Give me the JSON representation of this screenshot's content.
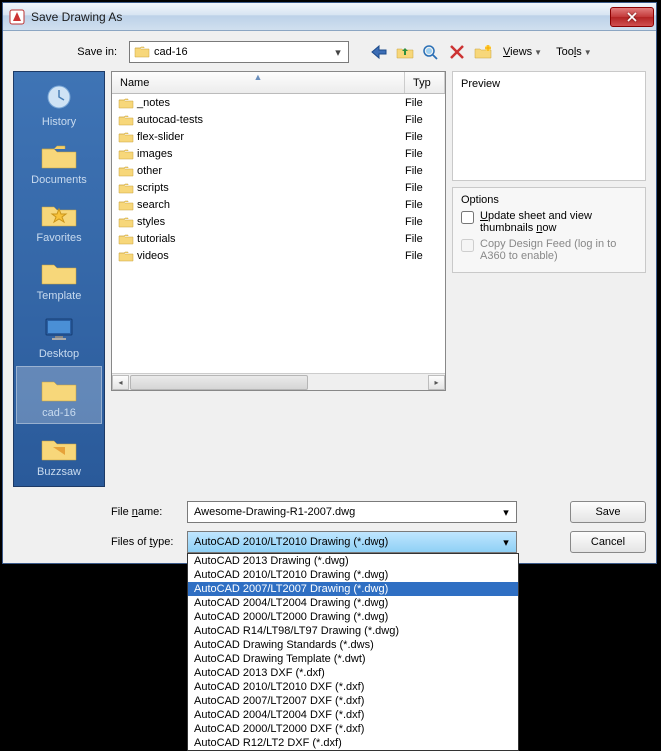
{
  "window": {
    "title": "Save Drawing As"
  },
  "toprow": {
    "savein_label": "Save in:",
    "savein_value": "cad-16",
    "views": "Views",
    "tools": "Tools"
  },
  "places": {
    "items": [
      {
        "label": "History"
      },
      {
        "label": "Documents"
      },
      {
        "label": "Favorites"
      },
      {
        "label": "Template"
      },
      {
        "label": "Desktop"
      },
      {
        "label": "cad-16"
      },
      {
        "label": "Buzzsaw"
      }
    ]
  },
  "list": {
    "col_name": "Name",
    "col_type": "Typ",
    "rows": [
      {
        "name": "_notes",
        "type": "File"
      },
      {
        "name": "autocad-tests",
        "type": "File"
      },
      {
        "name": "flex-slider",
        "type": "File"
      },
      {
        "name": "images",
        "type": "File"
      },
      {
        "name": "other",
        "type": "File"
      },
      {
        "name": "scripts",
        "type": "File"
      },
      {
        "name": "search",
        "type": "File"
      },
      {
        "name": "styles",
        "type": "File"
      },
      {
        "name": "tutorials",
        "type": "File"
      },
      {
        "name": "videos",
        "type": "File"
      }
    ]
  },
  "preview": {
    "title": "Preview"
  },
  "options": {
    "title": "Options",
    "update_label": "Update sheet and view thumbnails now",
    "copy_label": "Copy Design Feed (log in to A360 to enable)"
  },
  "bottom": {
    "filename_label": "File name:",
    "filename_value": "Awesome-Drawing-R1-2007.dwg",
    "filetype_label": "Files of type:",
    "filetype_value": "AutoCAD 2010/LT2010 Drawing (*.dwg)",
    "save": "Save",
    "cancel": "Cancel"
  },
  "dropdown": {
    "items": [
      "AutoCAD 2013 Drawing (*.dwg)",
      "AutoCAD 2010/LT2010 Drawing (*.dwg)",
      "AutoCAD 2007/LT2007 Drawing (*.dwg)",
      "AutoCAD 2004/LT2004 Drawing (*.dwg)",
      "AutoCAD 2000/LT2000 Drawing (*.dwg)",
      "AutoCAD R14/LT98/LT97 Drawing (*.dwg)",
      "AutoCAD Drawing Standards (*.dws)",
      "AutoCAD Drawing Template (*.dwt)",
      "AutoCAD 2013 DXF (*.dxf)",
      "AutoCAD 2010/LT2010 DXF (*.dxf)",
      "AutoCAD 2007/LT2007 DXF (*.dxf)",
      "AutoCAD 2004/LT2004 DXF (*.dxf)",
      "AutoCAD 2000/LT2000 DXF (*.dxf)",
      "AutoCAD R12/LT2 DXF (*.dxf)"
    ],
    "highlighted_index": 2
  }
}
